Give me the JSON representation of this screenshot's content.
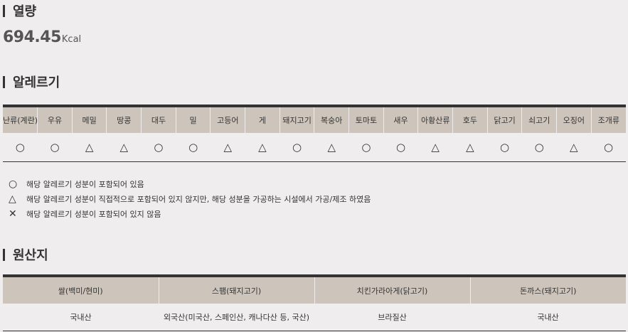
{
  "calorie": {
    "title": "열량",
    "value": "694.45",
    "unit": "Kcal"
  },
  "allergy": {
    "title": "알레르기",
    "headers": [
      "난류(계란)",
      "우유",
      "메밀",
      "땅콩",
      "대두",
      "밀",
      "고등어",
      "게",
      "돼지고기",
      "복숭아",
      "토마토",
      "새우",
      "아황산류",
      "호두",
      "닭고기",
      "쇠고기",
      "오징어",
      "조개류"
    ],
    "marks": [
      "○",
      "○",
      "△",
      "△",
      "○",
      "○",
      "△",
      "△",
      "○",
      "△",
      "○",
      "○",
      "△",
      "△",
      "○",
      "○",
      "△",
      "○"
    ]
  },
  "legend": [
    {
      "symbol": "○",
      "icon": "circle-icon",
      "text": "해당 알레르기 성분이 포함되어 있음"
    },
    {
      "symbol": "△",
      "icon": "triangle-icon",
      "text": "해당 알레르기 성분이 직접적으로 포함되어 있지 않지만, 해당 성분을 가공하는 시설에서 가공/제조 하였음"
    },
    {
      "symbol": "✕",
      "icon": "x-icon",
      "text": "해당 알레르기 성분이 포함되어 있지 않음"
    }
  ],
  "origin": {
    "title": "원산지",
    "headers": [
      "쌀(백미/현미)",
      "스팸(돼지고기)",
      "치킨가라아게(닭고기)",
      "돈까스(돼지고기)"
    ],
    "values": [
      "국내산",
      "외국산(미국산, 스페인산, 캐나다산 등, 국산)",
      "브라질산",
      "국내산"
    ]
  }
}
